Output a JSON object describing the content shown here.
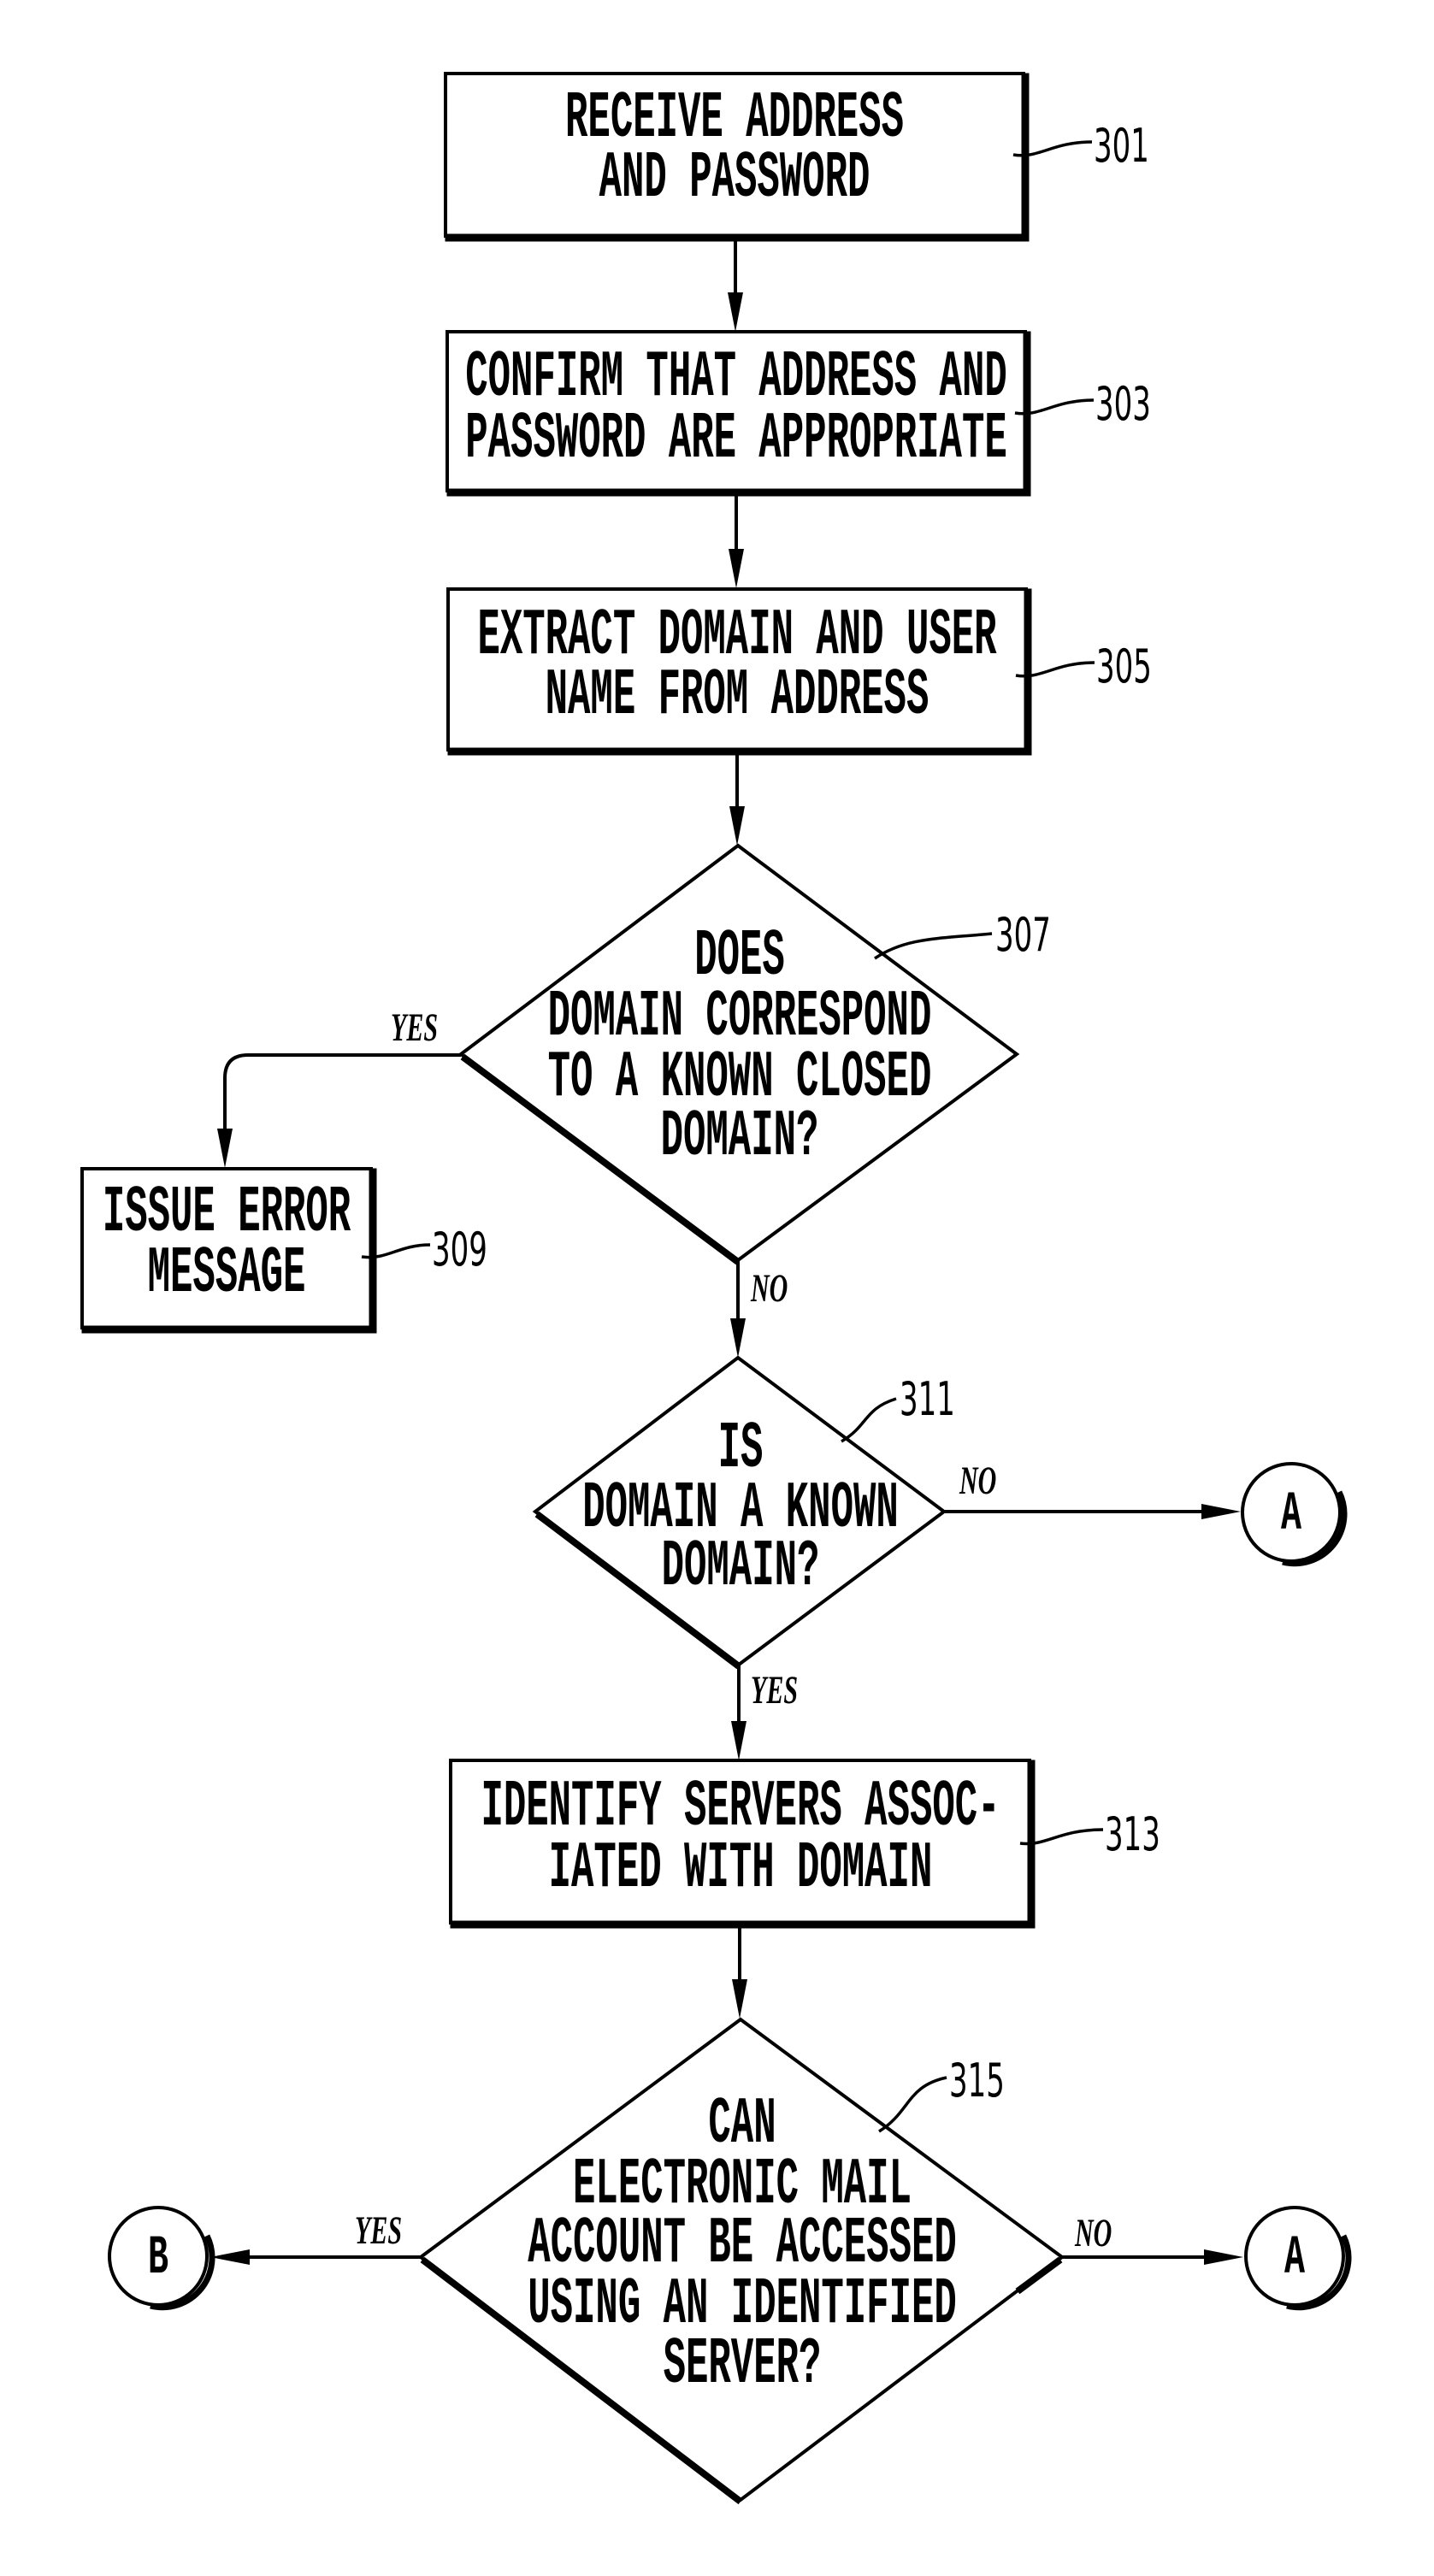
{
  "figure": {
    "type": "flowchart",
    "nodes": [
      {
        "id": "301",
        "shape": "process",
        "ref": "301",
        "lines": [
          "RECEIVE ADDRESS",
          "AND PASSWORD"
        ]
      },
      {
        "id": "303",
        "shape": "process",
        "ref": "303",
        "lines": [
          "CONFIRM THAT ADDRESS AND",
          "PASSWORD ARE APPROPRIATE"
        ]
      },
      {
        "id": "305",
        "shape": "process",
        "ref": "305",
        "lines": [
          "EXTRACT DOMAIN AND USER",
          "NAME FROM ADDRESS"
        ]
      },
      {
        "id": "307",
        "shape": "decision",
        "ref": "307",
        "lines": [
          "DOES",
          "DOMAIN CORRESPOND",
          "TO A KNOWN CLOSED",
          "DOMAIN?"
        ]
      },
      {
        "id": "309",
        "shape": "process",
        "ref": "309",
        "lines": [
          "ISSUE ERROR",
          "MESSAGE"
        ]
      },
      {
        "id": "311",
        "shape": "decision",
        "ref": "311",
        "lines": [
          "IS",
          "DOMAIN A KNOWN",
          "DOMAIN?"
        ]
      },
      {
        "id": "313",
        "shape": "process",
        "ref": "313",
        "lines": [
          "IDENTIFY SERVERS ASSOC-",
          "IATED WITH DOMAIN"
        ]
      },
      {
        "id": "315",
        "shape": "decision",
        "ref": "315",
        "lines": [
          "CAN",
          "ELECTRONIC MAIL",
          "ACCOUNT BE ACCESSED",
          "USING AN IDENTIFIED",
          "SERVER?"
        ]
      }
    ],
    "connectors": [
      {
        "id": "conn-a-1",
        "label": "A"
      },
      {
        "id": "conn-b",
        "label": "B"
      },
      {
        "id": "conn-a-2",
        "label": "A"
      }
    ],
    "edges": [
      {
        "from": "301",
        "to": "303",
        "label": ""
      },
      {
        "from": "303",
        "to": "305",
        "label": ""
      },
      {
        "from": "305",
        "to": "307",
        "label": ""
      },
      {
        "from": "307",
        "to": "309",
        "label": "YES"
      },
      {
        "from": "307",
        "to": "311",
        "label": "NO"
      },
      {
        "from": "311",
        "to": "conn-a-1",
        "label": "NO"
      },
      {
        "from": "311",
        "to": "313",
        "label": "YES"
      },
      {
        "from": "313",
        "to": "315",
        "label": ""
      },
      {
        "from": "315",
        "to": "conn-b",
        "label": "YES"
      },
      {
        "from": "315",
        "to": "conn-a-2",
        "label": "NO"
      }
    ]
  }
}
